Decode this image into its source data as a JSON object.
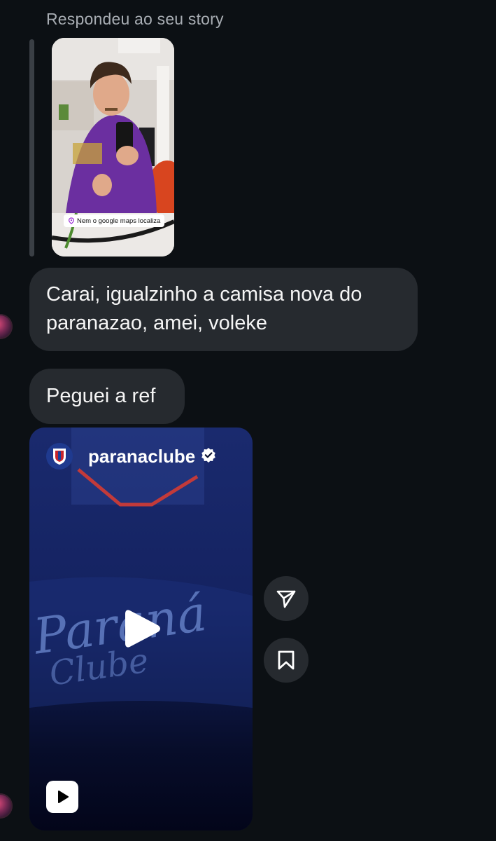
{
  "story_reply": {
    "label": "Respondeu ao seu story",
    "location_sticker": "Nem o google maps localiza"
  },
  "messages": [
    {
      "text": "Carai, igualzinho a camisa nova do paranazao, amei, voleke"
    },
    {
      "text": "Peguei a ref"
    }
  ],
  "reel": {
    "username": "paranaclube",
    "verified": true,
    "icons": {
      "play": "play-icon",
      "reels": "reels-icon",
      "verified": "verified-badge-icon"
    }
  },
  "actions": [
    {
      "icon": "share-icon"
    },
    {
      "icon": "bookmark-icon"
    }
  ],
  "colors": {
    "background": "#0c1014",
    "bubble": "#262a2f",
    "secondary_text": "#a8adb3",
    "reel_bg": "#0b1230"
  }
}
